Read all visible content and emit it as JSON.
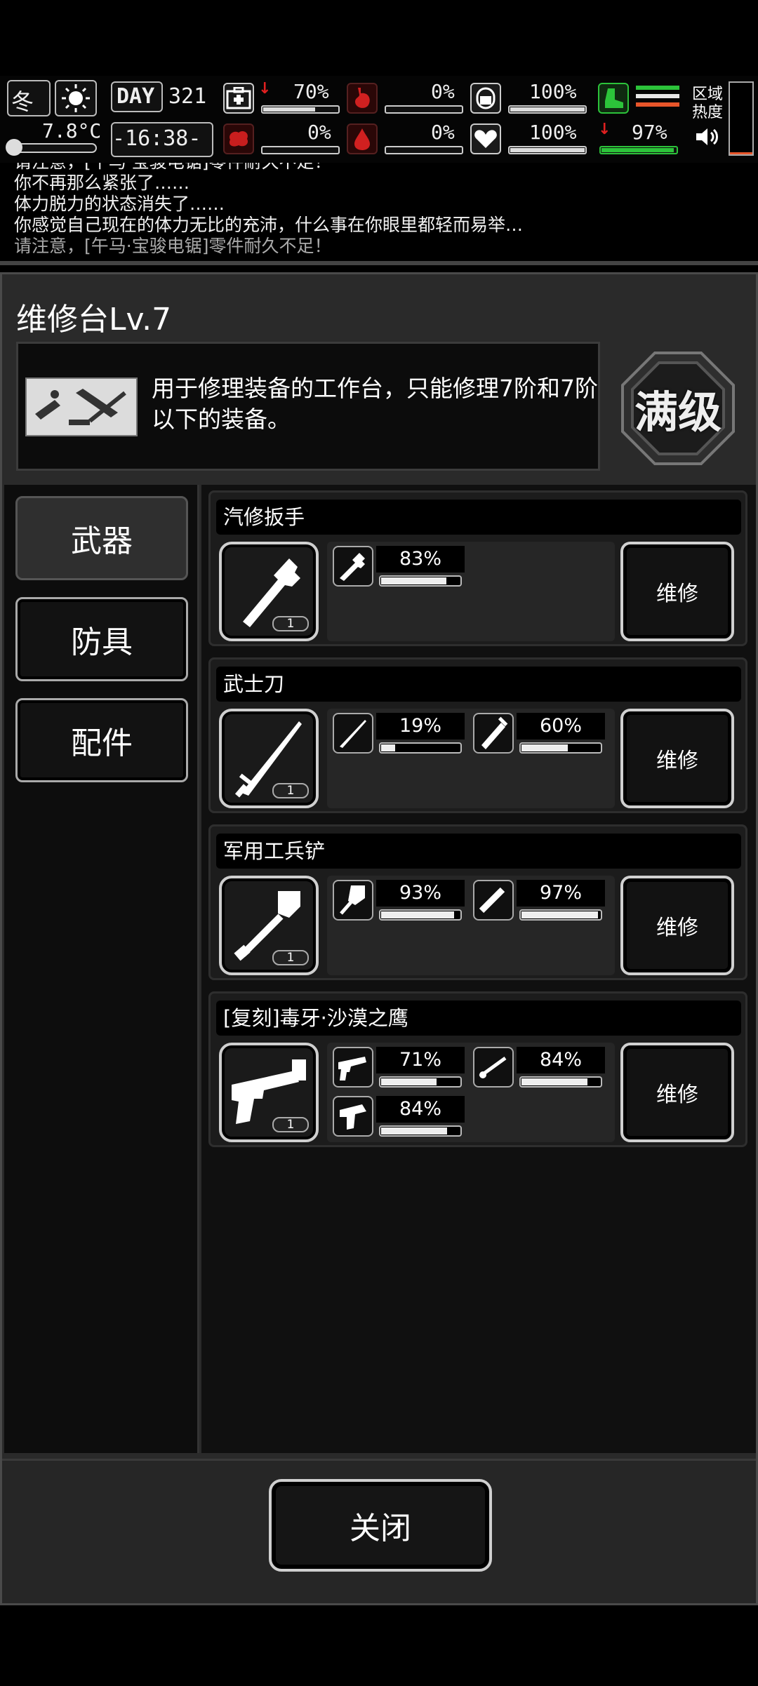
{
  "hud": {
    "season": "冬",
    "temperature": "7.8°C",
    "day_label": "DAY",
    "day": "321",
    "time": "-16:38-",
    "health_pct": "70%",
    "hunger_pct": "0%",
    "mind_pct": "100%",
    "brain_pct": "0%",
    "blood_pct": "0%",
    "heart_pct": "100%",
    "stamina_pct": "97%",
    "zone_heat_label": "区域\n热度",
    "bars": {
      "health": 0.7,
      "hunger": 0.0,
      "mind": 1.0,
      "brain": 0.0,
      "blood": 0.0,
      "heart": 1.0,
      "stamina": 0.97
    },
    "colors": {
      "danger": "#e02020",
      "stamina": "#2cc33a",
      "stamina_stripes": "#e8552a"
    }
  },
  "log": [
    {
      "text": "请注意，[午马·宝骏电锯]零件耐久不足！",
      "faded": false
    },
    {
      "text": "你不再那么紧张了……",
      "faded": false
    },
    {
      "text": "体力脱力的状态消失了……",
      "faded": false
    },
    {
      "text": "你感觉自己现在的体力无比的充沛，什么事在你眼里都轻而易举…",
      "faded": false
    },
    {
      "text": "请注意，[午马·宝骏电锯]零件耐久不足！",
      "faded": true
    }
  ],
  "panel": {
    "title": "维修台Lv.7",
    "description": "用于修理装备的工作台，只能修理7阶和7阶以下的装备。",
    "max_level_label": "满级"
  },
  "tabs": [
    "武器",
    "防具",
    "配件"
  ],
  "active_tab": 0,
  "items": [
    {
      "name": "汽修扳手",
      "count": "1",
      "repair_label": "维修",
      "parts": [
        {
          "icon": "wrench-part-icon",
          "pct": "83%",
          "value": 0.83
        }
      ]
    },
    {
      "name": "武士刀",
      "count": "1",
      "repair_label": "维修",
      "parts": [
        {
          "icon": "blade-part-icon",
          "pct": "19%",
          "value": 0.19
        },
        {
          "icon": "hilt-part-icon",
          "pct": "60%",
          "value": 0.6
        }
      ]
    },
    {
      "name": "军用工兵铲",
      "count": "1",
      "repair_label": "维修",
      "parts": [
        {
          "icon": "shovel-head-part-icon",
          "pct": "93%",
          "value": 0.93
        },
        {
          "icon": "handle-part-icon",
          "pct": "97%",
          "value": 0.97
        }
      ]
    },
    {
      "name": "[复刻]毒牙·沙漠之鹰",
      "count": "1",
      "repair_label": "维修",
      "parts": [
        {
          "icon": "pistol-frame-part-icon",
          "pct": "71%",
          "value": 0.71
        },
        {
          "icon": "barrel-part-icon",
          "pct": "84%",
          "value": 0.84
        },
        {
          "icon": "grip-part-icon",
          "pct": "84%",
          "value": 0.84
        }
      ]
    }
  ],
  "close_label": "关闭"
}
